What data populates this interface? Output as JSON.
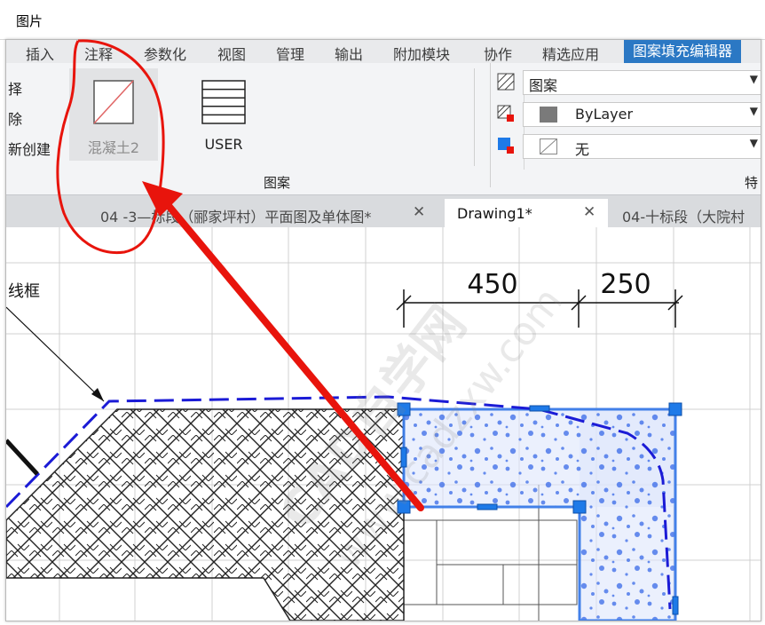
{
  "window": {
    "title": "图片"
  },
  "menu": {
    "items": [
      "插入",
      "注释",
      "参数化",
      "视图",
      "管理",
      "输出",
      "附加模块",
      "协作",
      "精选应用",
      "图案填充编辑器"
    ]
  },
  "ribbon": {
    "left_commands": [
      "择",
      "除",
      "新创建"
    ],
    "patterns": [
      {
        "label": "混凝土2",
        "selected": true
      },
      {
        "label": "USER",
        "selected": false
      }
    ],
    "panel_labels": {
      "pattern": "图案",
      "properties": "特"
    },
    "properties": {
      "pattern_type": "图案",
      "pattern_color": "ByLayer",
      "background_color": "无"
    }
  },
  "tabs": [
    {
      "label": "04 -3—标段（郦家坪村）平面图及单体图*",
      "active": false
    },
    {
      "label": "Drawing1*",
      "active": true
    },
    {
      "label": "04-十标段（大院村",
      "active": false
    }
  ],
  "drawing": {
    "dimensions": [
      "450",
      "250"
    ],
    "leader_text": "线框",
    "watermark_lines": [
      "CAD自学网",
      "www.cadzxw.com"
    ]
  },
  "colors": {
    "accent": "#2b78c4",
    "grip": "#1e7ae8",
    "hatch_dots": "#2f63e6",
    "dashed_boundary": "#1b1bd6",
    "annotation_red": "#e8140c"
  }
}
